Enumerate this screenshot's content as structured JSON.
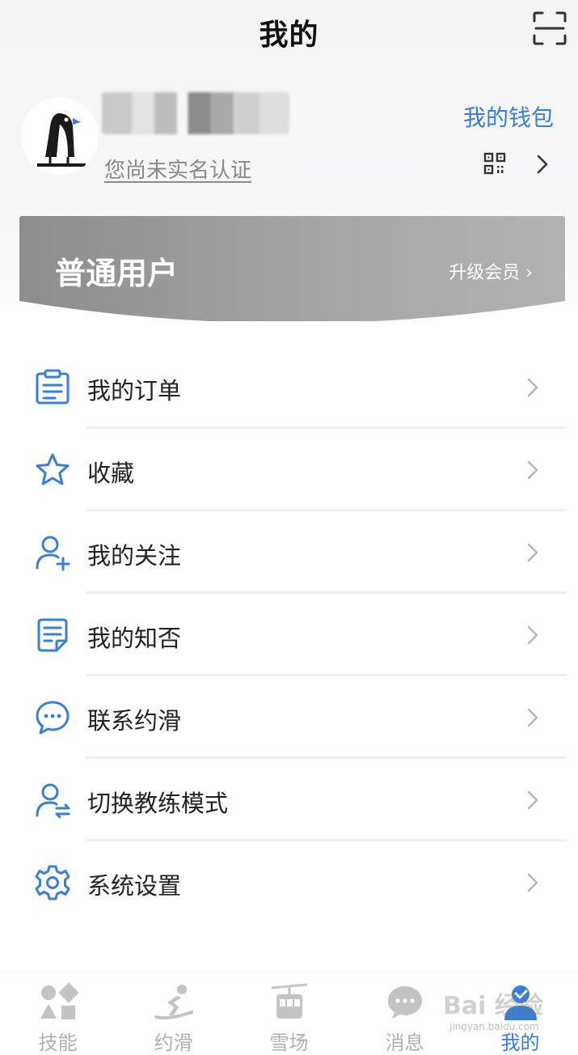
{
  "header": {
    "title": "我的",
    "scan_icon": "scan-icon"
  },
  "profile": {
    "user_name": "██ ███",
    "verify_text": "您尚未实名认证",
    "wallet_label": "我的钱包",
    "qr_icon": "qr-code-icon",
    "chevron_icon": "chevron-right-icon"
  },
  "member": {
    "level": "普通用户",
    "upgrade_label": "升级会员 ›"
  },
  "menu": {
    "items": [
      {
        "label": "我的订单",
        "icon": "clipboard-icon"
      },
      {
        "label": "收藏",
        "icon": "star-icon"
      },
      {
        "label": "我的关注",
        "icon": "person-add-icon"
      },
      {
        "label": "我的知否",
        "icon": "note-icon"
      },
      {
        "label": "联系约滑",
        "icon": "chat-bubble-icon"
      },
      {
        "label": "切换教练模式",
        "icon": "person-switch-icon"
      },
      {
        "label": "系统设置",
        "icon": "gear-icon"
      }
    ]
  },
  "tabbar": {
    "tabs": [
      {
        "label": "技能",
        "icon": "shapes-icon",
        "active": false
      },
      {
        "label": "约滑",
        "icon": "skier-icon",
        "active": false
      },
      {
        "label": "雪场",
        "icon": "cable-car-icon",
        "active": false
      },
      {
        "label": "消息",
        "icon": "message-icon",
        "active": false
      },
      {
        "label": "我的",
        "icon": "user-icon",
        "active": true
      }
    ]
  },
  "watermark": {
    "text": "Bai 经验",
    "sub": "jingyan.baidu.com"
  },
  "colors": {
    "accent": "#3a7fd5",
    "tab_inactive": "#b0b0b0",
    "card_gradient_start": "#8d8d8d",
    "card_gradient_end": "#b2b2b2"
  }
}
